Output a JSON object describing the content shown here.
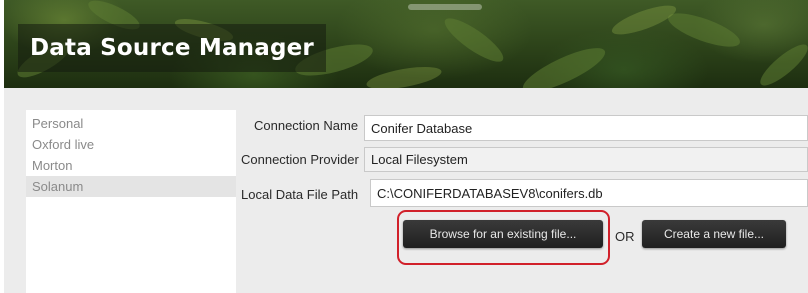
{
  "header": {
    "title": "Data Source Manager"
  },
  "sources": {
    "items": [
      {
        "label": "Personal",
        "selected": false
      },
      {
        "label": "Oxford live",
        "selected": false
      },
      {
        "label": "Morton",
        "selected": false
      },
      {
        "label": "Solanum",
        "selected": true
      }
    ]
  },
  "form": {
    "connection_name": {
      "label": "Connection Name",
      "value": "Conifer Database"
    },
    "connection_provider": {
      "label": "Connection Provider",
      "value": "Local Filesystem"
    },
    "local_path": {
      "label": "Local Data File Path",
      "value": "C:\\CONIFERDATABASEV8\\conifers.db"
    },
    "browse_label": "Browse for an existing file...",
    "or_label": "OR",
    "create_label": "Create a new file..."
  },
  "colors": {
    "highlight": "#d1202a",
    "button_dark": "#2a2a2a",
    "banner": "#2c4219"
  }
}
